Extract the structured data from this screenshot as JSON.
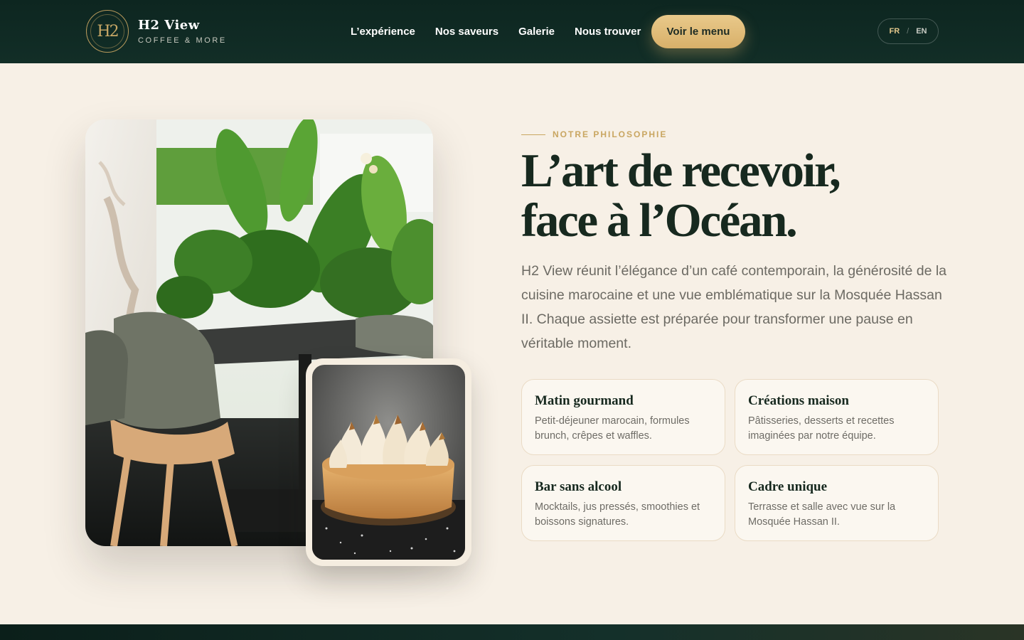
{
  "header": {
    "logo_mark": "H2",
    "brand_name": "H2 View",
    "brand_tagline": "COFFEE & MORE",
    "nav": [
      {
        "label": "L’expérience"
      },
      {
        "label": "Nos saveurs"
      },
      {
        "label": "Galerie"
      },
      {
        "label": "Nous trouver"
      }
    ],
    "cta_label": "Voir le menu",
    "lang": {
      "active": "FR",
      "separator": "/",
      "other": "EN"
    }
  },
  "hero": {
    "eyebrow": "NOTRE PHILOSOPHIE",
    "title_line1": "L’art de recevoir,",
    "title_line2": "face à l’Océan.",
    "lead": "H2 View réunit l’élégance d’un café contemporain, la générosité de la cuisine marocaine et une vue emblématique sur la Mosquée Hassan II. Chaque assiette est préparée pour transformer une pause en véritable moment."
  },
  "features": [
    {
      "title": "Matin gourmand",
      "text": "Petit-déjeuner marocain, formules brunch, crêpes et waffles."
    },
    {
      "title": "Créations maison",
      "text": "Pâtisseries, desserts et recettes imaginées par notre équipe."
    },
    {
      "title": "Bar sans alcool",
      "text": "Mocktails, jus pressés, smoothies et boissons signatures."
    },
    {
      "title": "Cadre unique",
      "text": "Terrasse et salle avec vue sur la Mosquée Hassan II."
    }
  ],
  "colors": {
    "header_bg": "#0d2620",
    "accent_gold": "#d8b06a",
    "page_bg": "#f7f0e6",
    "heading": "#17291f"
  }
}
